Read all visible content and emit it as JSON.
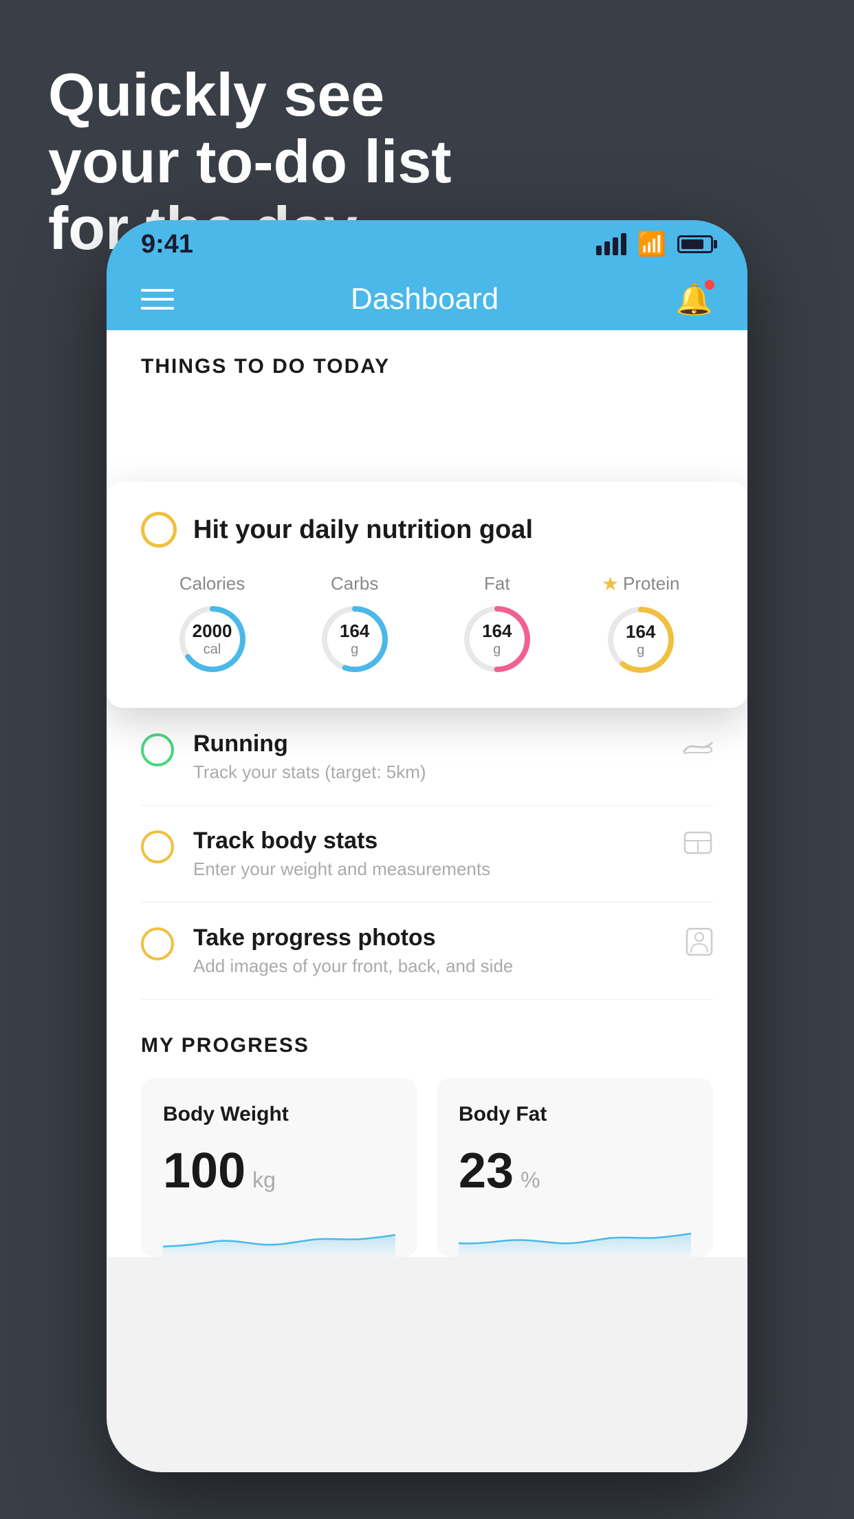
{
  "headline": {
    "line1": "Quickly see",
    "line2": "your to-do list",
    "line3": "for the day."
  },
  "status_bar": {
    "time": "9:41",
    "signal_label": "signal",
    "wifi_label": "wifi",
    "battery_label": "battery"
  },
  "nav": {
    "title": "Dashboard"
  },
  "things_header": "THINGS TO DO TODAY",
  "floating_card": {
    "title": "Hit your daily nutrition goal",
    "nutrients": [
      {
        "label": "Calories",
        "value": "2000",
        "unit": "cal",
        "color": "blue",
        "progress": 0.65,
        "star": false
      },
      {
        "label": "Carbs",
        "value": "164",
        "unit": "g",
        "color": "blue",
        "progress": 0.55,
        "star": false
      },
      {
        "label": "Fat",
        "value": "164",
        "unit": "g",
        "color": "pink",
        "progress": 0.5,
        "star": false
      },
      {
        "label": "Protein",
        "value": "164",
        "unit": "g",
        "color": "yellow",
        "progress": 0.6,
        "star": true
      }
    ]
  },
  "tasks": [
    {
      "name": "Running",
      "sub": "Track your stats (target: 5km)",
      "circle": "green",
      "icon": "shoe"
    },
    {
      "name": "Track body stats",
      "sub": "Enter your weight and measurements",
      "circle": "yellow",
      "icon": "scale"
    },
    {
      "name": "Take progress photos",
      "sub": "Add images of your front, back, and side",
      "circle": "yellow",
      "icon": "person"
    }
  ],
  "progress": {
    "title": "MY PROGRESS",
    "cards": [
      {
        "title": "Body Weight",
        "value": "100",
        "unit": "kg"
      },
      {
        "title": "Body Fat",
        "value": "23",
        "unit": "%"
      }
    ]
  }
}
